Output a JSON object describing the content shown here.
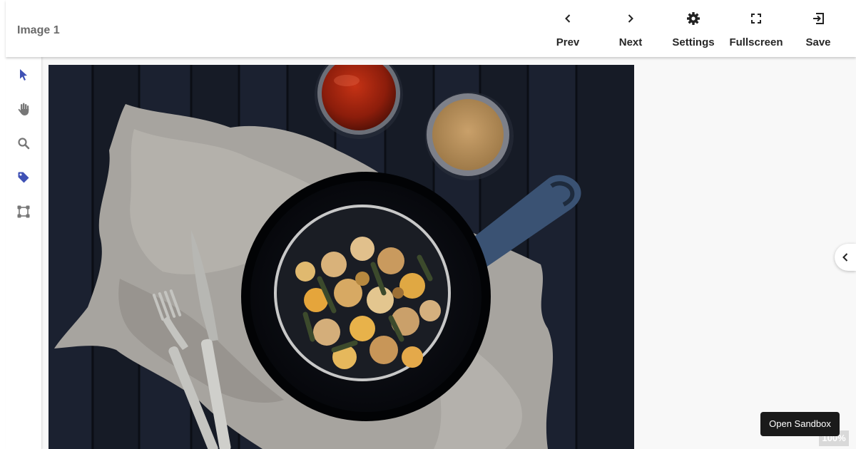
{
  "header": {
    "title": "Image 1",
    "buttons": {
      "prev": {
        "label": "Prev",
        "icon": "chevron-left-icon"
      },
      "next": {
        "label": "Next",
        "icon": "chevron-right-icon"
      },
      "settings": {
        "label": "Settings",
        "icon": "gear-icon"
      },
      "fullscreen": {
        "label": "Fullscreen",
        "icon": "fullscreen-icon"
      },
      "save": {
        "label": "Save",
        "icon": "save-exit-icon"
      }
    }
  },
  "tools": [
    {
      "name": "select-tool",
      "icon": "pointer-icon",
      "active": true
    },
    {
      "name": "pan-tool",
      "icon": "hand-icon",
      "active": false
    },
    {
      "name": "zoom-tool",
      "icon": "magnifier-icon",
      "active": false
    },
    {
      "name": "tag-tool",
      "icon": "tag-icon",
      "active": true
    },
    {
      "name": "bounding-box-tool",
      "icon": "bounding-box-icon",
      "active": false
    }
  ],
  "canvas": {
    "zoom_label": "100%",
    "sandbox_label": "Open Sandbox"
  },
  "colors": {
    "accent": "#3f51b5",
    "icon_gray": "#7a7a7a",
    "text_dark": "#262626",
    "tooltip_bg": "#1a1a1a"
  }
}
